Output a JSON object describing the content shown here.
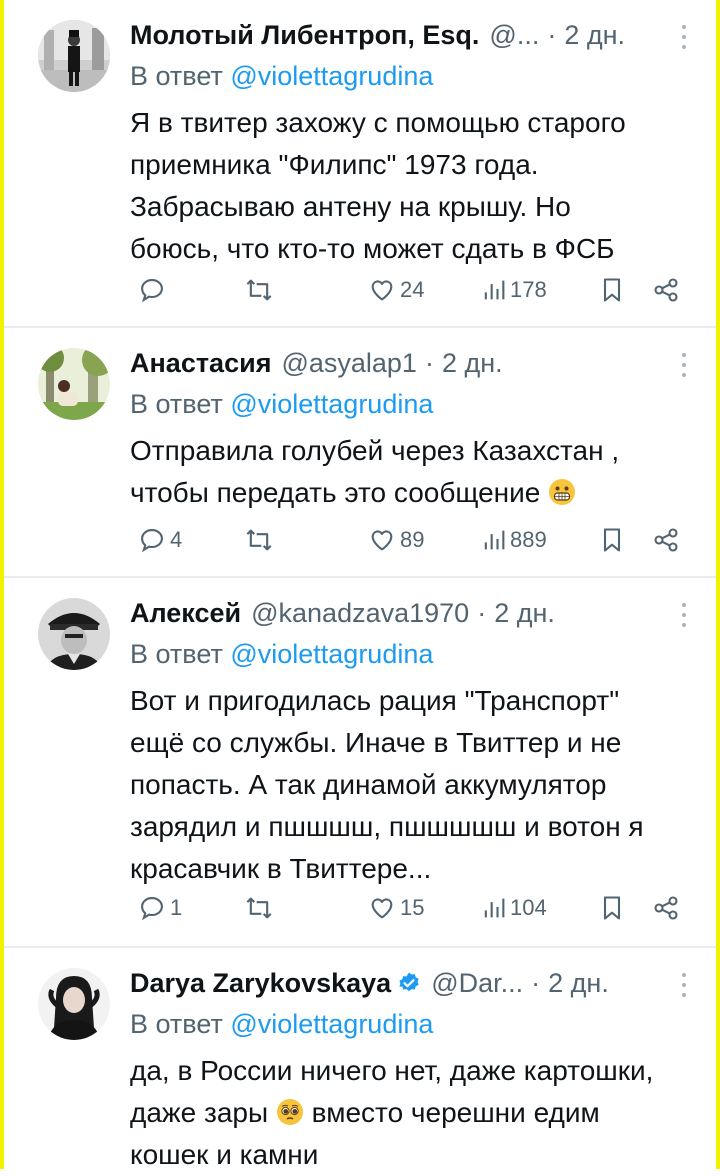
{
  "reply_prefix": "В ответ",
  "tweets": [
    {
      "name": "Молотый Либентроп, Esq.",
      "handle": "@...",
      "time": "2 дн.",
      "reply_to": "@violettagrudina",
      "text": "Я в твитер захожу с помощью старого\nприемника \"Филипс\" 1973 года.\nЗабрасываю антену на крышу. Но\nбоюсь, что кто-то может сдать в ФСБ",
      "replies": "",
      "likes": "24",
      "views": "178",
      "verified": false
    },
    {
      "name": "Анастасия",
      "handle": "@asyalap1",
      "time": "2 дн.",
      "reply_to": "@violettagrudina",
      "text_line1": "Отправила голубей через Казахстан ,",
      "text_line2": "чтобы передать это сообщение",
      "emoji": "grinning-face",
      "replies": "4",
      "likes": "89",
      "views": "889",
      "verified": false
    },
    {
      "name": "Алексей",
      "handle": "@kanadzava1970",
      "time": "2 дн.",
      "reply_to": "@violettagrudina",
      "text": "Вот и пригодилась рация \"Транспорт\"\nещё со службы. Иначе в Твиттер и не\nпопасть. А так динамой аккумулятор\nзарядил и пшшшш, пшшшшш и вотон я\nкрасавчик в Твиттере...",
      "replies": "1",
      "likes": "15",
      "views": "104",
      "verified": false
    },
    {
      "name": "Darya Zarykovskaya",
      "handle": "@Dar...",
      "time": "2 дн.",
      "reply_to": "@violettagrudina",
      "text_line1": "да, в России ничего нет, даже картошки,",
      "text_line2_a": "даже зары",
      "text_line2_b": "вместо черешни едим",
      "text_line3": "кошек и камни",
      "emoji": "pleading-face",
      "verified": true
    }
  ],
  "colors": {
    "accent": "#1d9bf0",
    "secondary_text": "#536471",
    "divider": "#e8ecee",
    "frame": "#f2f200"
  },
  "icons": [
    "reply-icon",
    "retweet-icon",
    "like-icon",
    "views-icon",
    "bookmark-icon",
    "share-icon",
    "more-icon",
    "verified-badge-icon"
  ]
}
